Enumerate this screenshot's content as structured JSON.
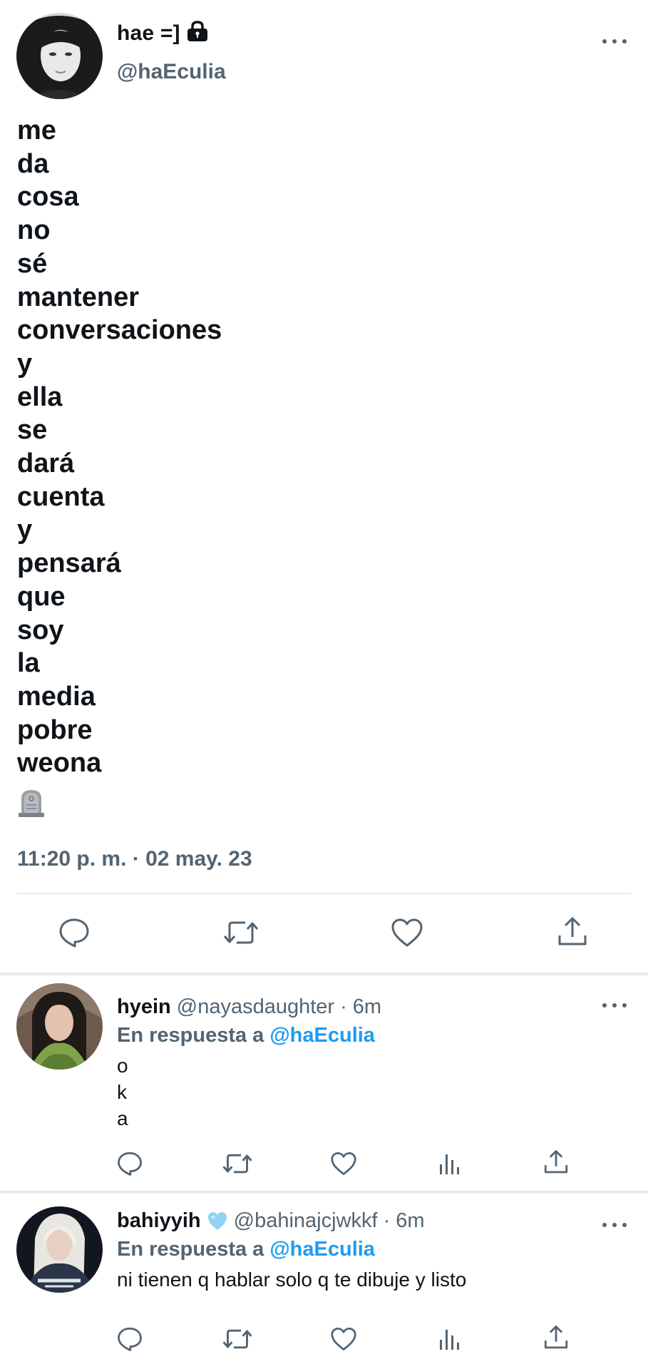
{
  "main_tweet": {
    "display_name": "hae =]",
    "handle": "@haEculia",
    "text_lines": [
      "me",
      "da",
      "cosa",
      "no",
      "sé",
      "mantener",
      "conversaciones",
      "y",
      "ella",
      "se",
      "dará",
      "cuenta",
      "y",
      "pensará",
      "que",
      "soy",
      "la",
      "media",
      "pobre",
      "weona"
    ],
    "emoji": "headstone",
    "timestamp": "11:20 p. m. · 02 may. 23",
    "protected_icon": "lock-icon"
  },
  "replies": [
    {
      "display_name": "hyein",
      "handle": "@nayasdaughter",
      "time": "· 6m",
      "reply_prefix": "En respuesta a",
      "reply_mention": "@haEculia",
      "body_lines": [
        "o",
        "k",
        "a"
      ]
    },
    {
      "display_name": "bahiyyih",
      "handle": "@bahinajcjwkkf",
      "time": "· 6m",
      "reply_prefix": "En respuesta a",
      "reply_mention": "@haEculia",
      "body_lines": [
        "ni tienen q hablar solo q te dibuje y listo"
      ],
      "badge": "light-blue-heart"
    }
  ],
  "icons": {
    "reply": "reply-icon",
    "retweet": "retweet-icon",
    "like": "heart-icon",
    "share": "share-icon",
    "views": "views-icon",
    "more": "more-icon"
  },
  "colors": {
    "text_primary": "#0f1419",
    "text_secondary": "#536471",
    "accent": "#1d9bf0",
    "divider": "#e6e9ec"
  }
}
